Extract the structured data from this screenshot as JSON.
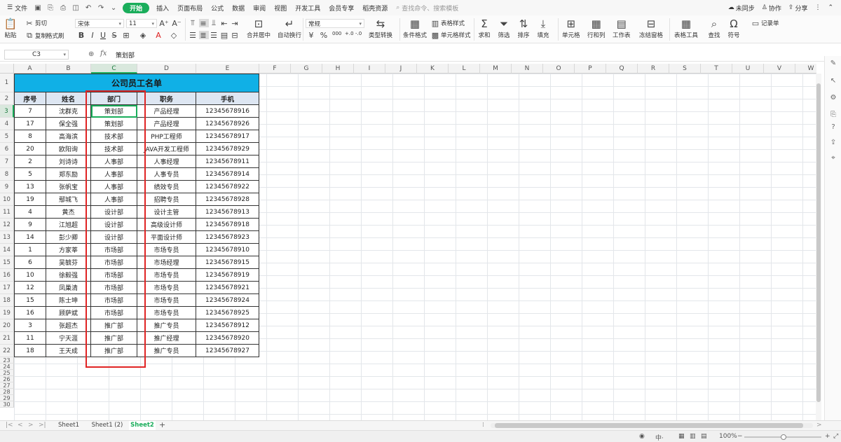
{
  "menubar": {
    "file": "文件",
    "start": "开始",
    "tabs": [
      "插入",
      "页面布局",
      "公式",
      "数据",
      "审阅",
      "视图",
      "开发工具",
      "会员专享",
      "稻壳资源"
    ],
    "search_placeholder": "查找命令、搜索模板",
    "right": {
      "sync": "未同步",
      "collab": "协作",
      "share": "分享"
    }
  },
  "ribbon": {
    "paste": "粘贴",
    "cut": "剪切",
    "copy": "复制",
    "format_painter": "格式刷",
    "font_name": "宋体",
    "font_size": "11",
    "merge_center": "合并居中",
    "wrap_text": "自动换行",
    "number_format": "常规",
    "type_convert": "类型转换",
    "cond_format": "条件格式",
    "table_style": "表格样式",
    "cell_style": "单元格样式",
    "sum": "求和",
    "filter": "筛选",
    "sort": "排序",
    "fill": "填充",
    "cell": "单元格",
    "row_col": "行和列",
    "worksheet": "工作表",
    "freeze": "冻结窗格",
    "table_tools": "表格工具",
    "find": "查找",
    "symbol": "符号",
    "record": "记录单",
    "currency_symbol": "¥",
    "percent_symbol": "%",
    "thousands_symbol": "000"
  },
  "formula": {
    "cell_ref": "C3",
    "fx": "fx",
    "content": "策划部"
  },
  "columns": [
    "A",
    "B",
    "C",
    "D",
    "E",
    "F",
    "G",
    "H",
    "I",
    "J",
    "K",
    "L",
    "M",
    "N",
    "O",
    "P",
    "Q",
    "R",
    "S",
    "T",
    "U",
    "V",
    "W"
  ],
  "row_numbers": [
    "1",
    "2",
    "3",
    "4",
    "5",
    "6",
    "7",
    "8",
    "9",
    "10",
    "11",
    "12",
    "13",
    "14",
    "15",
    "16",
    "17",
    "18",
    "19",
    "20",
    "21",
    "22",
    "23",
    "24",
    "25",
    "26",
    "27",
    "28",
    "29",
    "30"
  ],
  "table": {
    "title": "公司员工名单",
    "headers": [
      "序号",
      "姓名",
      "部门",
      "职务",
      "手机"
    ],
    "rows": [
      [
        "7",
        "沈群克",
        "策划部",
        "产品经理",
        "12345678916"
      ],
      [
        "17",
        "保全强",
        "策划部",
        "产品经理",
        "12345678926"
      ],
      [
        "8",
        "高海滨",
        "技术部",
        "PHP工程师",
        "12345678917"
      ],
      [
        "20",
        "欧阳询",
        "技术部",
        "JAVA开发工程师",
        "12345678929"
      ],
      [
        "2",
        "刘诗诗",
        "人事部",
        "人事经理",
        "12345678911"
      ],
      [
        "5",
        "郑东励",
        "人事部",
        "人事专员",
        "12345678914"
      ],
      [
        "13",
        "张帆宝",
        "人事部",
        "绩效专员",
        "12345678922"
      ],
      [
        "19",
        "鄢城飞",
        "人事部",
        "招聘专员",
        "12345678928"
      ],
      [
        "4",
        "黄杰",
        "设计部",
        "设计主管",
        "12345678913"
      ],
      [
        "9",
        "江旭超",
        "设计部",
        "高级设计师",
        "12345678918"
      ],
      [
        "14",
        "彭少卿",
        "设计部",
        "平面设计师",
        "12345678923"
      ],
      [
        "1",
        "方家莘",
        "市场部",
        "市场专员",
        "12345678910"
      ],
      [
        "6",
        "吴毓芬",
        "市场部",
        "市场经理",
        "12345678915"
      ],
      [
        "10",
        "徐毅强",
        "市场部",
        "市场专员",
        "12345678919"
      ],
      [
        "12",
        "凤巢清",
        "市场部",
        "市场专员",
        "12345678921"
      ],
      [
        "15",
        "陈士坤",
        "市场部",
        "市场专员",
        "12345678924"
      ],
      [
        "16",
        "顾萨斌",
        "市场部",
        "市场专员",
        "12345678925"
      ],
      [
        "3",
        "张超杰",
        "推广部",
        "推广专员",
        "12345678912"
      ],
      [
        "11",
        "宁天涯",
        "推广部",
        "推广经理",
        "12345678920"
      ],
      [
        "18",
        "王天成",
        "推广部",
        "推广专员",
        "12345678927"
      ]
    ]
  },
  "sheets": [
    "Sheet1",
    "Sheet1 (2)",
    "Sheet2"
  ],
  "active_sheet": "Sheet2",
  "status": {
    "zoom": "100%"
  },
  "colors": {
    "accent": "#1aad5b",
    "title_fill": "#10b0e6",
    "header_fill": "#dde6f2",
    "highlight_box": "#e02424"
  }
}
